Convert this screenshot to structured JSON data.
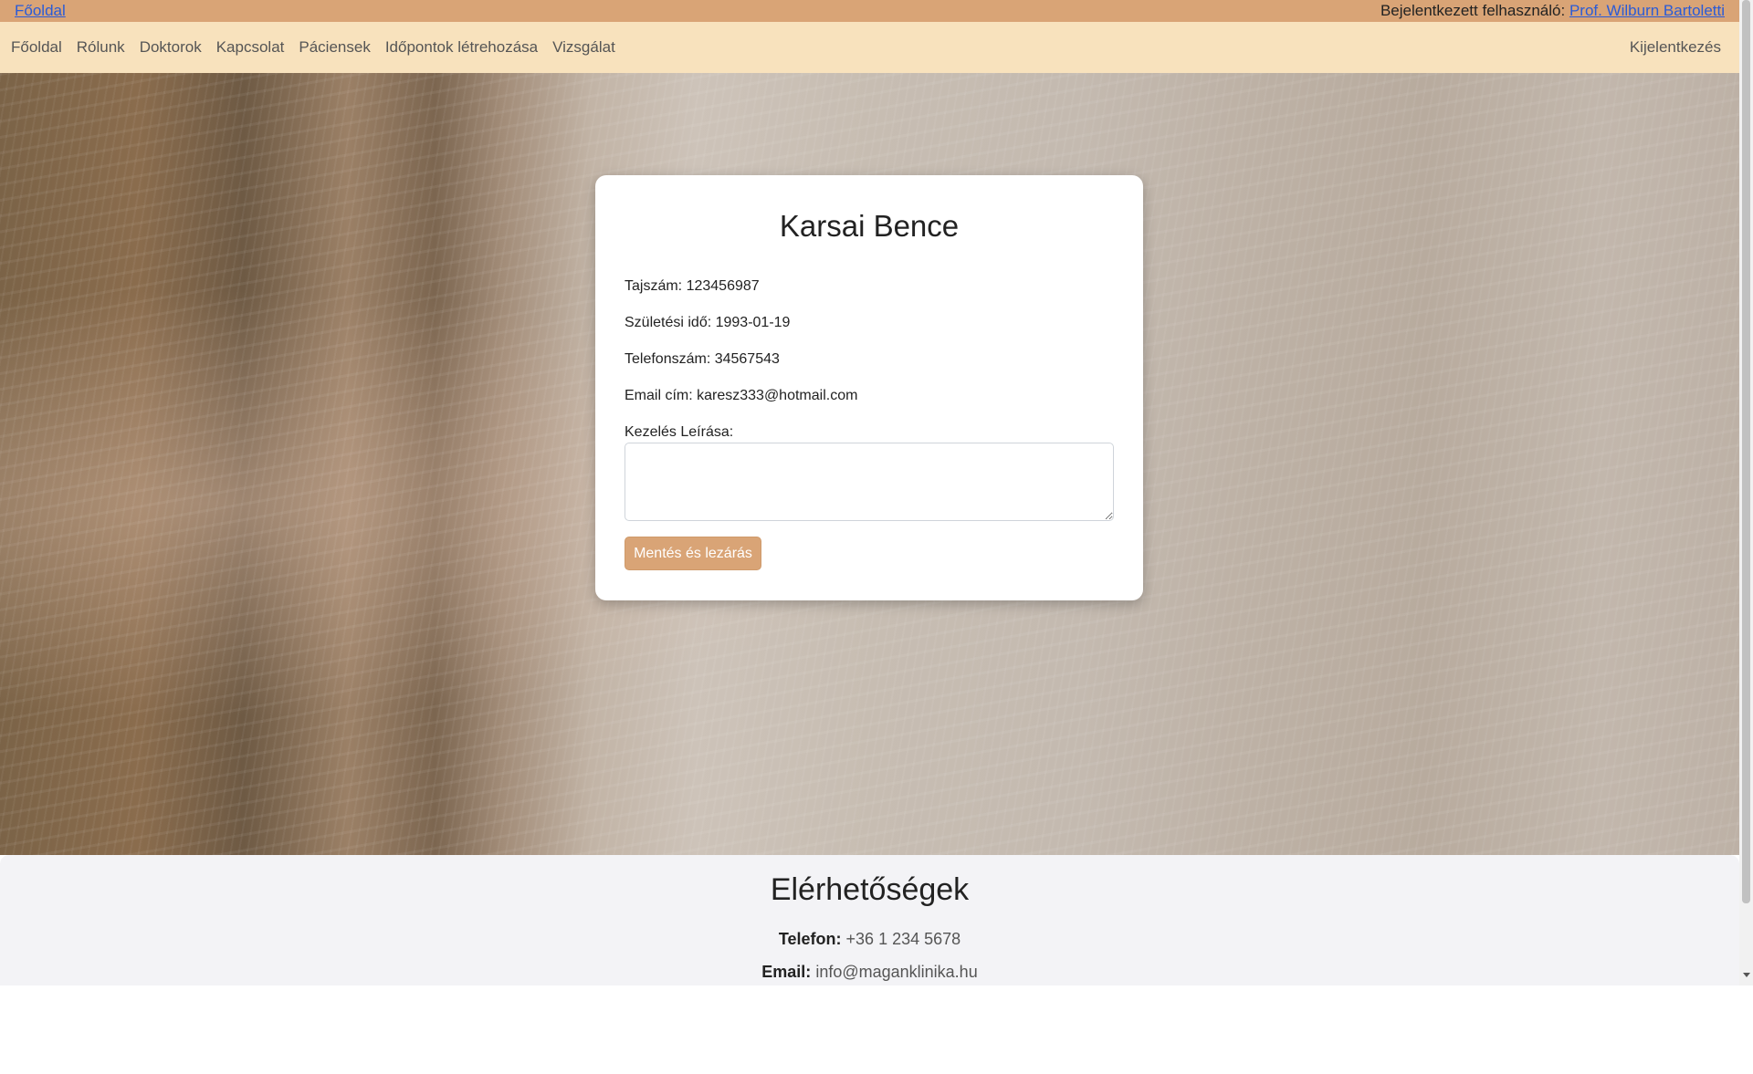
{
  "topbar": {
    "home_link": "Főoldal",
    "user_prefix": "Bejelentkezett felhasználó:",
    "user_name": "Prof. Wilburn Bartoletti"
  },
  "nav": {
    "items": [
      "Főoldal",
      "Rólunk",
      "Doktorok",
      "Kapcsolat",
      "Páciensek",
      "Időpontok létrehozása",
      "Vizsgálat"
    ],
    "logout": "Kijelentkezés"
  },
  "patient": {
    "name": "Karsai Bence",
    "taj": "Tajszám: 123456987",
    "birth": "Születési idő: 1993-01-19",
    "phone": "Telefonszám: 34567543",
    "email": "Email cím: karesz333@hotmail.com",
    "description_label": "Kezelés Leírása:",
    "description_value": "",
    "save_button": "Mentés és lezárás"
  },
  "footer": {
    "title": "Elérhetőségek",
    "phone_label": "Telefon:",
    "phone_value": "+36 1 234 5678",
    "email_label": "Email:",
    "email_value": "info@maganklinika.hu"
  },
  "colors": {
    "accent": "#d9a476",
    "navbar_bg": "#f8e2bd",
    "footer_bg": "#f3f3f6"
  }
}
